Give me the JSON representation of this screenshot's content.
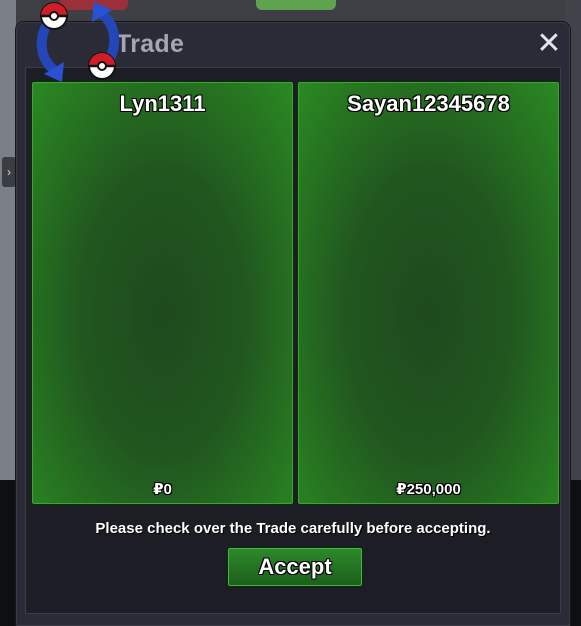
{
  "window": {
    "title": "Trade",
    "close_glyph": "✕",
    "icon": "trade-swap-icon"
  },
  "offers": {
    "left": {
      "player": "Lyn1311",
      "currency_symbol": "₽",
      "amount": "0"
    },
    "right": {
      "player": "Sayan12345678",
      "currency_symbol": "₽",
      "amount": "250,000"
    }
  },
  "notice": "Please check over the Trade carefully before accepting.",
  "accept_label": "Accept",
  "colors": {
    "panel_green": "#21571f",
    "button_green": "#2e8a2c",
    "window_bg": "#2b2b38"
  }
}
